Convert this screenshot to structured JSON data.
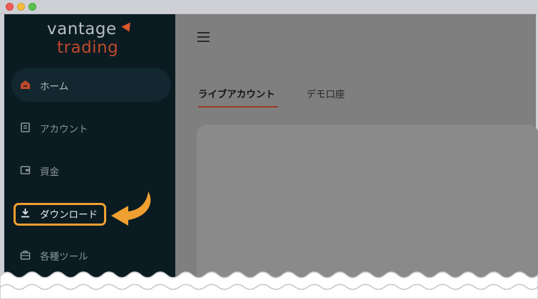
{
  "window": {
    "controls": [
      "close",
      "minimize",
      "zoom"
    ]
  },
  "brand": {
    "line1": "vantage",
    "line2": "trading",
    "accent_color": "#c0492a"
  },
  "sidebar": {
    "items": [
      {
        "label": "ホーム",
        "icon": "home-icon",
        "active": true
      },
      {
        "label": "アカウント",
        "icon": "account-icon",
        "active": false
      },
      {
        "label": "資金",
        "icon": "wallet-icon",
        "active": false
      },
      {
        "label": "ダウンロード",
        "icon": "download-icon",
        "active": false,
        "highlighted": true
      },
      {
        "label": "各種ツール",
        "icon": "toolbox-icon",
        "active": false
      }
    ]
  },
  "main": {
    "menu_icon": "hamburger-menu-icon",
    "tabs": [
      {
        "label": "ライブアカウント",
        "selected": true
      },
      {
        "label": "デモ口座",
        "selected": false
      }
    ]
  },
  "annotation": {
    "arrow_color": "#f0a030",
    "points_to": "ダウンロード"
  }
}
